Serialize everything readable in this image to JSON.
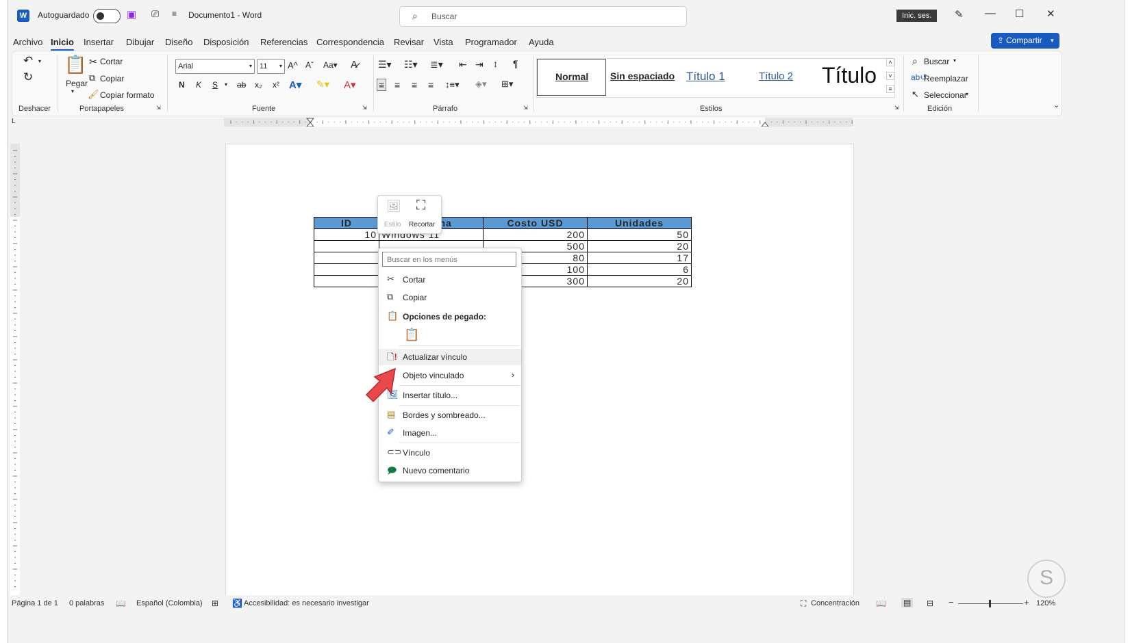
{
  "title_bar": {
    "autosave_label": "Autoguardado",
    "doc_title": "Documento1  -  Word",
    "search_placeholder": "Buscar",
    "signin_label": "Inic. ses.",
    "minimize": "—",
    "maximize": "☐",
    "close": "✕"
  },
  "tabs": [
    "Archivo",
    "Inicio",
    "Insertar",
    "Dibujar",
    "Diseño",
    "Disposición",
    "Referencias",
    "Correspondencia",
    "Revisar",
    "Vista",
    "Programador",
    "Ayuda"
  ],
  "share_label": "Compartir",
  "ribbon": {
    "undo_group": "Deshacer",
    "clipboard": {
      "paste": "Pegar",
      "cut": "Cortar",
      "copy": "Copiar",
      "format_painter": "Copiar formato",
      "group": "Portapapeles"
    },
    "font": {
      "family": "Arial",
      "size": "11",
      "bold": "N",
      "italic": "K",
      "underline": "S",
      "strike": "ab",
      "sub": "x₂",
      "sup": "x²",
      "group": "Fuente"
    },
    "paragraph_group": "Párrafo",
    "styles": {
      "normal": "Normal",
      "no_spacing": "Sin espaciado",
      "h1": "Título 1",
      "h2": "Título 2",
      "title": "Título",
      "group": "Estilos"
    },
    "editing": {
      "find": "Buscar",
      "replace": "Reemplazar",
      "select": "Seleccionar",
      "group": "Edición"
    }
  },
  "table": {
    "headers": [
      "ID",
      "Sistema",
      "Costo USD",
      "Unidades"
    ],
    "rows": [
      [
        "10",
        "Windows 11",
        "200",
        "50"
      ],
      [
        "",
        "",
        "500",
        "20"
      ],
      [
        "",
        "",
        "80",
        "17"
      ],
      [
        "",
        "",
        "100",
        "6"
      ],
      [
        "",
        "",
        "300",
        "20"
      ]
    ]
  },
  "mini_toolbar": {
    "style": "Estilo",
    "crop": "Recortar"
  },
  "context_menu": {
    "search_placeholder": "Buscar en los menús",
    "items": [
      "Cortar",
      "Copiar",
      "Opciones de pegado:",
      "Actualizar vínculo",
      "Objeto  vinculado",
      "Insertar título...",
      "Bordes y sombreado...",
      "Imagen...",
      "Vínculo",
      "Nuevo comentario"
    ]
  },
  "status_bar": {
    "page": "Página 1 de 1",
    "words": "0 palabras",
    "language": "Español (Colombia)",
    "accessibility": "Accesibilidad: es necesario investigar",
    "focus": "Concentración",
    "zoom": "120%"
  },
  "colors": {
    "accent": "#185abd",
    "table_header": "#5b9bd5",
    "pointer_arrow": "#e8474c"
  }
}
